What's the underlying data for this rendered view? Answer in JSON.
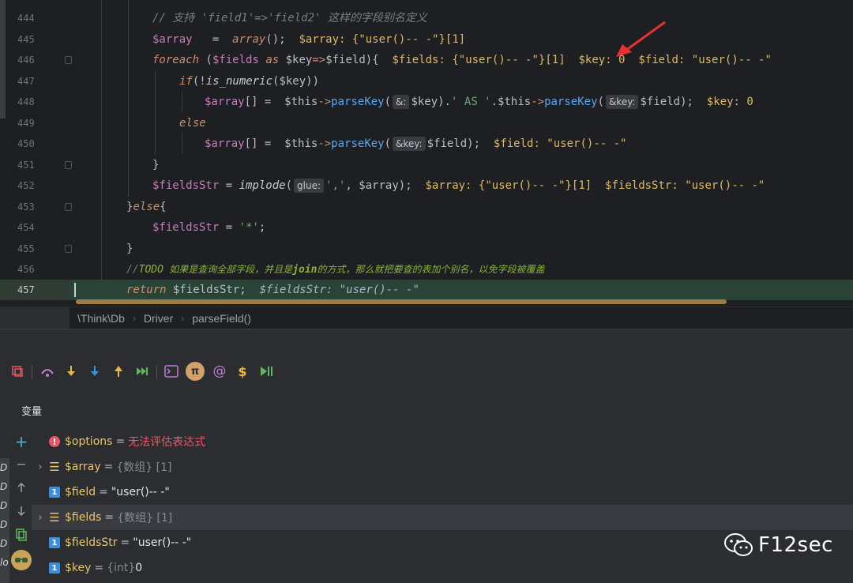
{
  "editor": {
    "lines": [
      {
        "num": "444"
      },
      {
        "num": "445"
      },
      {
        "num": "446"
      },
      {
        "num": "447"
      },
      {
        "num": "448"
      },
      {
        "num": "449"
      },
      {
        "num": "450"
      },
      {
        "num": "451"
      },
      {
        "num": "452"
      },
      {
        "num": "453"
      },
      {
        "num": "454"
      },
      {
        "num": "455"
      },
      {
        "num": "456"
      },
      {
        "num": "457"
      }
    ],
    "code": {
      "l444_comment": "// 支持 'field1'=>'field2' 这样的字段别名定义",
      "l445_var": "$array",
      "l445_eq": "   =  ",
      "l445_fn": "array",
      "l445_end": "();",
      "l445_inline": "  $array: {\"user()-- -\"}[1]",
      "l446_kw": "foreach",
      "l446_open": " (",
      "l446_fields": "$fields",
      "l446_as": " as ",
      "l446_key": "$key",
      "l446_arrow": "=>",
      "l446_field": "$field",
      "l446_close": "){",
      "l446_inline": "  $fields: {\"user()-- -\"}[1]  $key: 0  $field: \"user()-- -\"",
      "l447_kw": "if",
      "l447_neg": "(!",
      "l447_fn": "is_numeric",
      "l447_open": "(",
      "l447_key": "$key",
      "l447_close": "))",
      "l448_arr": "$array",
      "l448_eq": "[] =  ",
      "l448_this": "$this",
      "l448_arrow": "->",
      "l448_m": "parseKey",
      "l448_p": "(",
      "l448_hint1": "&:",
      "l448_key": "$key",
      "l448_mid": ").",
      "l448_str": "' AS '",
      "l448_dot": ".",
      "l448_this2": "$this",
      "l448_arrow2": "->",
      "l448_m2": "parseKey",
      "l448_p2": "(",
      "l448_hint2": "&key:",
      "l448_field": "$field",
      "l448_end": ");",
      "l448_inline": "  $key: 0",
      "l449_kw": "else",
      "l450_arr": "$array",
      "l450_eq": "[] =  ",
      "l450_this": "$this",
      "l450_arrow": "->",
      "l450_m": "parseKey",
      "l450_p": "(",
      "l450_hint": "&key:",
      "l450_field": "$field",
      "l450_end": ");",
      "l450_inline": "  $field: \"user()-- -\"",
      "l451_brace": "}",
      "l452_var": "$fieldsStr",
      "l452_eq": " = ",
      "l452_fn": "implode",
      "l452_p": "(",
      "l452_hint": "glue:",
      "l452_str": "','",
      "l452_comma": ", ",
      "l452_arr": "$array",
      "l452_end": ");",
      "l452_inline": "  $array: {\"user()-- -\"}[1]  $fieldsStr: \"user()-- -\"",
      "l453_brace": "}",
      "l453_kw": "else",
      "l453_open": "{",
      "l454_var": "$fieldsStr",
      "l454_eq": " = ",
      "l454_str": "'*'",
      "l454_end": ";",
      "l455_brace": "}",
      "l456_slash": "//",
      "l456_todo": "TODO",
      "l456_text": " 如果是查询全部字段，并且是",
      "l456_join": "join",
      "l456_text2": "的方式，那么就把要查的表加个别名，以免字段被覆盖",
      "l457_kw": "return",
      "l457_var": " $fieldsStr",
      "l457_end": ";",
      "l457_inline": "  $fieldsStr: \"user()-- -\""
    }
  },
  "breadcrumb": [
    "\\Think\\Db",
    "Driver",
    "parseField()"
  ],
  "icons": {
    "sep": "›"
  },
  "debugger": {
    "panel_title": "变量",
    "toolbar": [
      "restore-layout-icon",
      "step-over-icon",
      "step-into-icon",
      "force-step-into-icon",
      "step-out-icon",
      "run-to-cursor-icon",
      "console-icon",
      "evaluate-icon",
      "watch-icon",
      "php-icon",
      "resume-icon"
    ],
    "variables": [
      {
        "name": "$options",
        "eq": " = ",
        "type": "",
        "value": "无法评估表达式",
        "kind": "error",
        "expandable": false,
        "selected": false
      },
      {
        "name": "$array",
        "eq": " = ",
        "type": "{数组} [1]",
        "value": "",
        "kind": "array",
        "expandable": true,
        "selected": false
      },
      {
        "name": "$field",
        "eq": " = ",
        "type": "",
        "value": "\"user()-- -\"",
        "kind": "primitive",
        "expandable": false,
        "selected": false
      },
      {
        "name": "$fields",
        "eq": " = ",
        "type": "{数组} [1]",
        "value": "",
        "kind": "array",
        "expandable": true,
        "selected": true
      },
      {
        "name": "$fieldsStr",
        "eq": " = ",
        "type": "",
        "value": "\"user()-- -\"",
        "kind": "primitive",
        "expandable": false,
        "selected": false
      },
      {
        "name": "$key",
        "eq": " = ",
        "type": "{int} ",
        "value": "0",
        "kind": "primitive",
        "expandable": false,
        "selected": false
      }
    ]
  },
  "watermark": {
    "text": "F12sec"
  },
  "colors": {
    "annotation_arrow": "#e8322f",
    "current_line": "#294436"
  }
}
